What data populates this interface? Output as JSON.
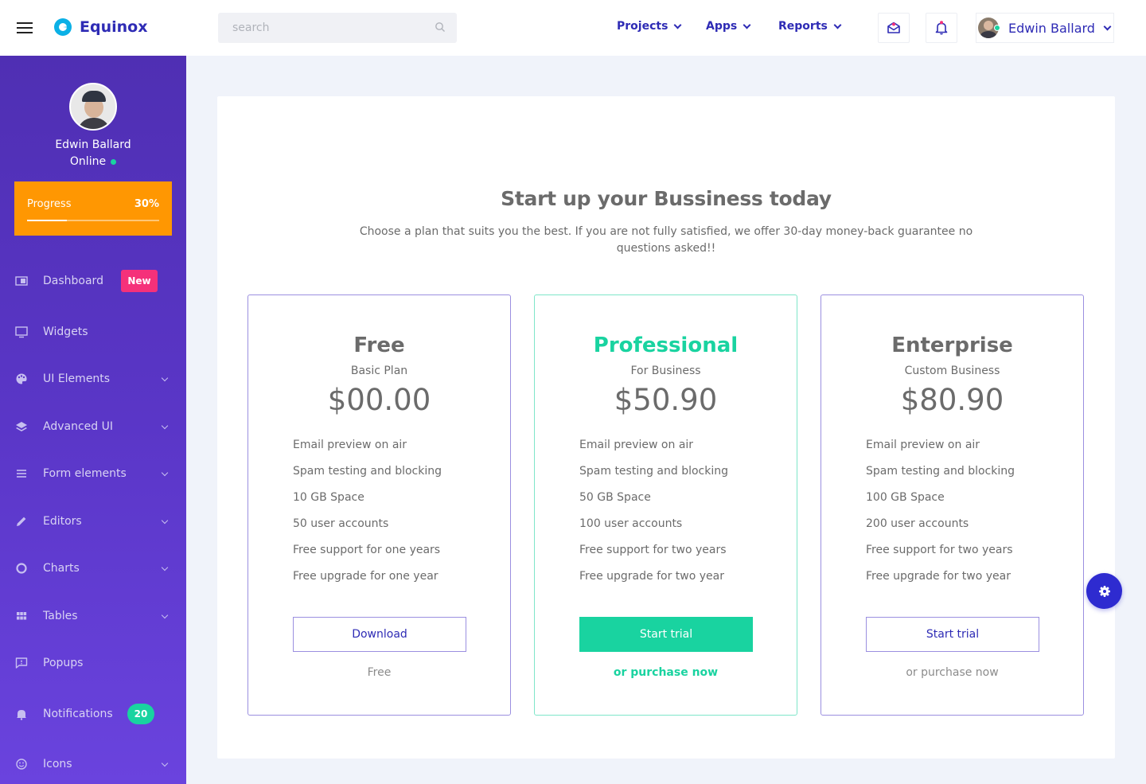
{
  "brand": {
    "name": "Equinox"
  },
  "search": {
    "placeholder": "search"
  },
  "topnav": [
    {
      "label": "Projects"
    },
    {
      "label": "Apps"
    },
    {
      "label": "Reports"
    }
  ],
  "user": {
    "name": "Edwin Ballard",
    "status": "Online"
  },
  "sidebar": {
    "progress": {
      "label": "Progress",
      "value_text": "30%",
      "fraction": 0.3
    },
    "items": [
      {
        "label": "Dashboard",
        "badge": "New",
        "icon": "dashboard-icon"
      },
      {
        "label": "Widgets",
        "icon": "monitor-icon"
      },
      {
        "label": "UI Elements",
        "icon": "palette-icon"
      },
      {
        "label": "Advanced UI",
        "icon": "layers-icon"
      },
      {
        "label": "Form elements",
        "icon": "list-icon"
      },
      {
        "label": "Editors",
        "icon": "pencil-icon"
      },
      {
        "label": "Charts",
        "icon": "donut-chart-icon"
      },
      {
        "label": "Tables",
        "icon": "grid-icon"
      },
      {
        "label": "Popups",
        "icon": "message-icon"
      },
      {
        "label": "Notifications",
        "badge": "20",
        "icon": "bell-icon"
      },
      {
        "label": "Icons",
        "icon": "smiley-icon"
      }
    ]
  },
  "pricing": {
    "title": "Start up your Bussiness today",
    "subtitle": "Choose a plan that suits you the best. If you are not fully satisfied, we offer 30-day money-back guarantee no questions asked!!",
    "plans": [
      {
        "name": "Free",
        "tagline": "Basic Plan",
        "price": "$00.00",
        "features": [
          "Email preview on air",
          "Spam testing and blocking",
          "10 GB Space",
          "50 user accounts",
          "Free support for one years",
          "Free upgrade for one year"
        ],
        "button": "Download",
        "footer": "Free"
      },
      {
        "name": "Professional",
        "tagline": "For Business",
        "price": "$50.90",
        "features": [
          "Email preview on air",
          "Spam testing and blocking",
          "50 GB Space",
          "100 user accounts",
          "Free support for two years",
          "Free upgrade for two year"
        ],
        "button": "Start trial",
        "footer": "or purchase now"
      },
      {
        "name": "Enterprise",
        "tagline": "Custom Business",
        "price": "$80.90",
        "features": [
          "Email preview on air",
          "Spam testing and blocking",
          "100 GB Space",
          "200 user accounts",
          "Free support for two years",
          "Free upgrade for two year"
        ],
        "button": "Start trial",
        "footer": "or purchase now"
      }
    ]
  },
  "colors": {
    "brand": "#2e2bb5",
    "accent_green": "#19d3a0",
    "progress_orange": "#ff9702",
    "badge_pink": "#f5317a",
    "sidebar_top": "#4f2fb3",
    "sidebar_bottom": "#6a43de"
  }
}
